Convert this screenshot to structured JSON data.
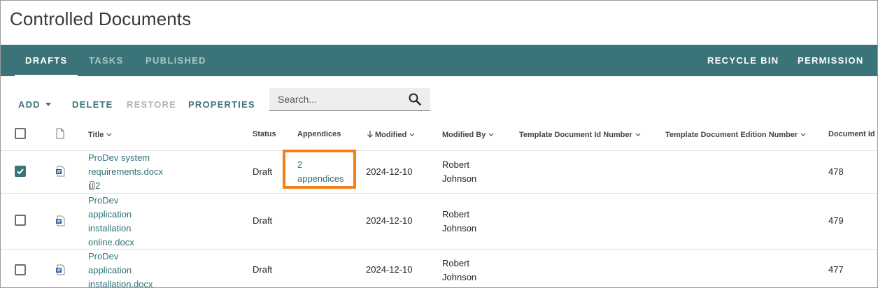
{
  "page": {
    "title": "Controlled Documents"
  },
  "nav": {
    "tabs": [
      {
        "label": "DRAFTS",
        "active": true
      },
      {
        "label": "TASKS",
        "active": false
      },
      {
        "label": "PUBLISHED",
        "active": false
      }
    ],
    "recycle_bin": "RECYCLE BIN",
    "permission": "PERMISSION"
  },
  "toolbar": {
    "add": "ADD",
    "delete": "DELETE",
    "restore": "RESTORE",
    "properties": "PROPERTIES",
    "search_placeholder": "Search..."
  },
  "table": {
    "headers": {
      "title": "Title",
      "status": "Status",
      "appendices": "Appendices",
      "modified": "Modified",
      "modified_by": "Modified By",
      "template_doc_id": "Template Document Id Number",
      "template_doc_edition": "Template Document Edition Number",
      "document_id": "Document Id"
    },
    "rows": [
      {
        "checked": true,
        "title_lines": [
          "ProDev system",
          "requirements.docx"
        ],
        "attachments": "2",
        "status": "Draft",
        "appendices_lines": [
          "2",
          "appendices"
        ],
        "modified": "2024-12-10",
        "modified_by_lines": [
          "Robert",
          "Johnson"
        ],
        "document_id": "478"
      },
      {
        "checked": false,
        "title_lines": [
          "ProDev",
          "application",
          "installation",
          "online.docx"
        ],
        "status": "Draft",
        "modified": "2024-12-10",
        "modified_by_lines": [
          "Robert",
          "Johnson"
        ],
        "document_id": "479"
      },
      {
        "checked": false,
        "title_lines": [
          "ProDev",
          "application",
          "installation.docx"
        ],
        "status": "Draft",
        "modified": "2024-12-10",
        "modified_by_lines": [
          "Robert",
          "Johnson"
        ],
        "document_id": "477"
      }
    ]
  },
  "colors": {
    "accent": "#3b7478",
    "highlight": "#f57f17",
    "link": "#2f7178"
  }
}
